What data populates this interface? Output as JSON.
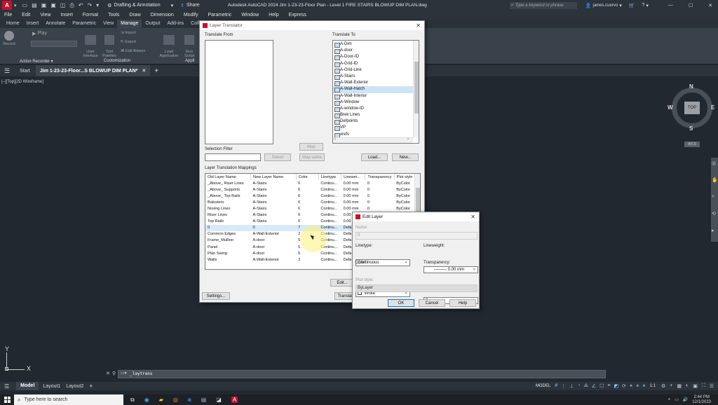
{
  "app": {
    "title": "Autodesk AutoCAD 2024   Jim 1-23-23-Floor Plan - Level 1 FIRE STAIRS BLOWUP DIM PLAN.dwg",
    "workspace": "Drafting & Annotation",
    "share_label": "Share",
    "search_placeholder": "Type a keyword or phrase",
    "user": "james.cuervo",
    "logo_letter": "A"
  },
  "menu": [
    "File",
    "Edit",
    "View",
    "Insert",
    "Format",
    "Tools",
    "Draw",
    "Dimension",
    "Modify",
    "Parametric",
    "Window",
    "Help",
    "Express"
  ],
  "ribbon_tabs": [
    "Home",
    "Insert",
    "Annotate",
    "Parametric",
    "View",
    "Manage",
    "Output",
    "Add-ins",
    "Collab"
  ],
  "ribbon_active": "Manage",
  "ribbon": {
    "record": "Record",
    "play": "Play",
    "action_recorder": "Action Recorder ▾",
    "user_interface": "User\nInterface",
    "tool_palettes": "Tool\nPalettes",
    "import": "Import",
    "export": "Export",
    "edit_aliases": "Edit Aliases",
    "customization": "Customization",
    "load_application": "Load\nApplication",
    "run_script": "Run\nScript",
    "appl": "Appli"
  },
  "doc_tabs": {
    "start": "Start",
    "active": "Jim 1-23-23-Floor...S BLOWUP DIM PLAN*"
  },
  "viewport_label": "[–][Top][2D Wireframe]",
  "viewcube": {
    "n": "N",
    "s": "S",
    "e": "E",
    "w": "W",
    "top": "TOP",
    "wcs": "WCS"
  },
  "ucs": {
    "x": "X",
    "y": "Y"
  },
  "command_text": "_laytrans",
  "layer_translator": {
    "title": "Layer Translator",
    "translate_from": "Translate From",
    "translate_to": "Translate To",
    "to_layers": [
      "A-Dim",
      "A-door",
      "A-Door-ID",
      "A-Grid-ID",
      "A-Grid-Line",
      "A-Stairs",
      "A-Wall-Exterior",
      "A-Wall-Hatch",
      "A-Wall-Interior",
      "A-Window",
      "A-window-ID",
      "Brek Lines",
      "Defpoints",
      "VP",
      "xrefs"
    ],
    "selected_to": "A-Wall-Hatch",
    "selection_filter": "Selection Filter",
    "select_btn": "Select",
    "map_btn": "Map",
    "map_same_btn": "Map same",
    "load_btn": "Load...",
    "new_btn": "New...",
    "mappings_label": "Layer Translation Mappings",
    "columns": [
      "Old Layer Name",
      "New Layer Name",
      "Color",
      "Linetype",
      "Linewei...",
      "Transparency",
      "Plot style"
    ],
    "rows": [
      [
        "_Above_ Riser Lines",
        "A-Stairs",
        "6",
        "Continu...",
        "0.00 mm",
        "0",
        "ByColor"
      ],
      [
        "_Above_ Supports",
        "A-Stairs",
        "6",
        "Continu...",
        "0.00 mm",
        "0",
        "ByColor"
      ],
      [
        "_Above_ Top Rails",
        "A-Stairs",
        "6",
        "Continu...",
        "0.00 mm",
        "0",
        "ByColor"
      ],
      [
        "Balusters",
        "A-Stairs",
        "6",
        "Continu...",
        "0.00 mm",
        "0",
        "ByColor"
      ],
      [
        "Nosing Lines",
        "A-Stairs",
        "6",
        "Continu...",
        "0.00 mm",
        "0",
        "ByColor"
      ],
      [
        "Riser Lines",
        "A-Stairs",
        "6",
        "Continu...",
        "0.00 mm",
        "0",
        "ByColor"
      ],
      [
        "Top Rails",
        "A-Stairs",
        "6",
        "Continu...",
        "0.00 mm",
        "0",
        "ByColor"
      ],
      [
        "0",
        "0",
        "7",
        "Continu...",
        "Defa",
        "",
        ""
      ],
      [
        "Common Edges",
        "A-Wall-Exterior",
        "2",
        "Continu...",
        "Defa",
        "",
        ""
      ],
      [
        "Frame_Mullion",
        "A-door",
        "5",
        "Continu...",
        "Defa",
        "",
        ""
      ],
      [
        "Panel",
        "A-door",
        "5",
        "Continu...",
        "Defa",
        "",
        ""
      ],
      [
        "Plan Swing",
        "A-door",
        "5",
        "Continu...",
        "Defa",
        "",
        ""
      ],
      [
        "Walls",
        "A-Wall-Exterior",
        "2",
        "Continu...",
        "Defa",
        "",
        ""
      ]
    ],
    "selected_row": 7,
    "edit_btn": "Edit...",
    "settings_btn": "Settings...",
    "translate_btn": "Translate"
  },
  "edit_layer": {
    "title": "Edit Layer",
    "name_label": "Name:",
    "name_value": "0",
    "linetype_label": "Linetype:",
    "linetype_value": "Continuous",
    "lineweight_label": "Lineweight:",
    "lineweight_value": "——— 0.00 mm",
    "color_label": "Color:",
    "color_value": "White",
    "transparency_label": "Transparency:",
    "transparency_value": "0",
    "plotstyle_label": "Plot style:",
    "plotstyle_value": "ByLayer",
    "ok": "OK",
    "cancel": "Cancel",
    "help": "Help"
  },
  "status": {
    "model_tab": "Model",
    "layout1": "Layout1",
    "layout2": "Layout2",
    "model_btn": "MODEL",
    "scale": "1:1"
  },
  "taskbar": {
    "search_placeholder": "Type here to search",
    "time": "2:44 PM",
    "date": "12/1/2023"
  },
  "colors": {
    "accent": "#c8102e",
    "bg": "#212830",
    "dialog": "#f0f0f0",
    "selection": "#cde4f7"
  }
}
